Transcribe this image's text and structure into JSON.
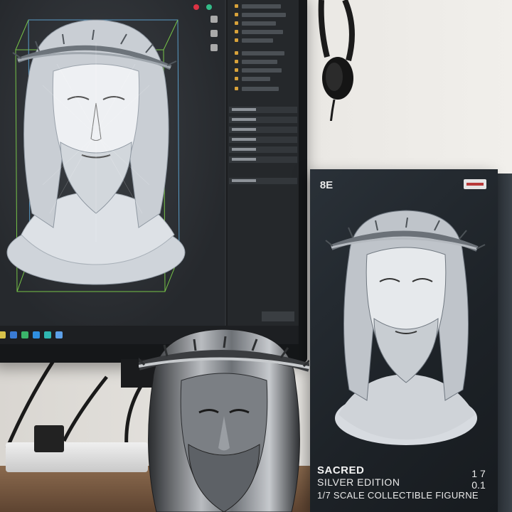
{
  "scene": {
    "description_colors": {
      "wall": "#e4e1dc",
      "screen_bg": "#2d3034",
      "wireframe": "#d9dde2",
      "bbox_green": "#7fd44a",
      "box_dark": "#1f252a",
      "silver": "#a9acb0"
    }
  },
  "box": {
    "brand_logo_text": "8E",
    "title": "SACRED",
    "subtitle": "SILVER EDITION",
    "line3": "1/7 SCALE COLLECTIBLE FIGURNE",
    "num_top": "1 7",
    "num_bottom": "0.1"
  },
  "icons": {
    "taskbar": [
      "start-icon",
      "search-icon",
      "app-icon-green",
      "app-icon-blue",
      "app-icon-teal",
      "app-icon-blue2"
    ]
  }
}
